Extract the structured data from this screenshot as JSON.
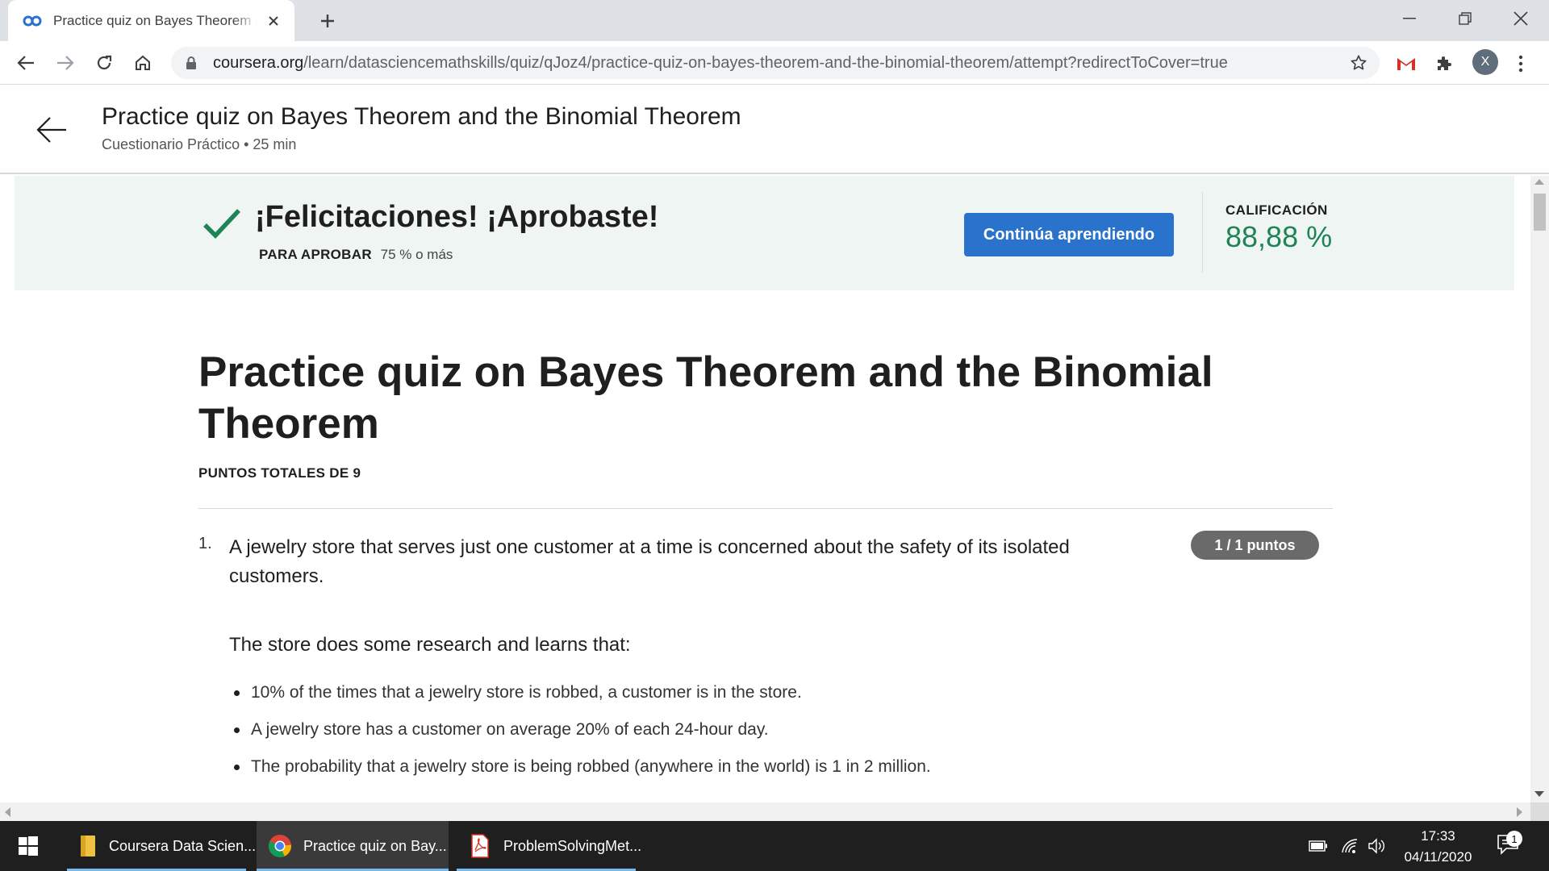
{
  "browser": {
    "tab_title": "Practice quiz on Bayes Theorem and the Binomial Theorem",
    "url_host": "coursera.org",
    "url_path": "/learn/datasciencemathskills/quiz/qJoz4/practice-quiz-on-bayes-theorem-and-the-binomial-theorem/attempt?redirectToCover=true",
    "profile_initial": "X"
  },
  "header": {
    "title": "Practice quiz on Bayes Theorem and the Binomial Theorem",
    "subtitle": "Cuestionario Práctico • 25 min"
  },
  "result": {
    "message": "¡Felicitaciones! ¡Aprobaste!",
    "pass_label": "PARA APROBAR",
    "pass_value": "75 % o más",
    "continue_label": "Continúa aprendiendo",
    "grade_label": "CALIFICACIÓN",
    "grade_value": "88,88 %",
    "accent_color": "#1f8354",
    "button_color": "#2a73cc"
  },
  "quiz": {
    "title": "Practice quiz on Bayes Theorem and the Binomial Theorem",
    "total_points": "PUNTOS TOTALES DE 9",
    "questions": [
      {
        "number": "1.",
        "text": "A jewelry store that serves just one customer at a time is concerned about the safety of its isolated customers.",
        "points": "1 / 1 puntos",
        "intro": "The store does some research and learns that:",
        "facts": [
          "10% of the times that a jewelry store is robbed, a customer is in the store.",
          "A jewelry store has a customer on average 20% of each 24-hour day.",
          "The probability that a jewelry store is being robbed (anywhere in the world) is 1 in 2 million."
        ]
      }
    ]
  },
  "taskbar": {
    "items": [
      {
        "label": "Coursera Data Scien...",
        "icon": "folder-icon"
      },
      {
        "label": "Practice quiz on Bay...",
        "icon": "chrome-icon"
      },
      {
        "label": "ProblemSolvingMet...",
        "icon": "pdf-icon"
      }
    ],
    "time": "17:33",
    "date": "04/11/2020",
    "notification_count": "1"
  }
}
